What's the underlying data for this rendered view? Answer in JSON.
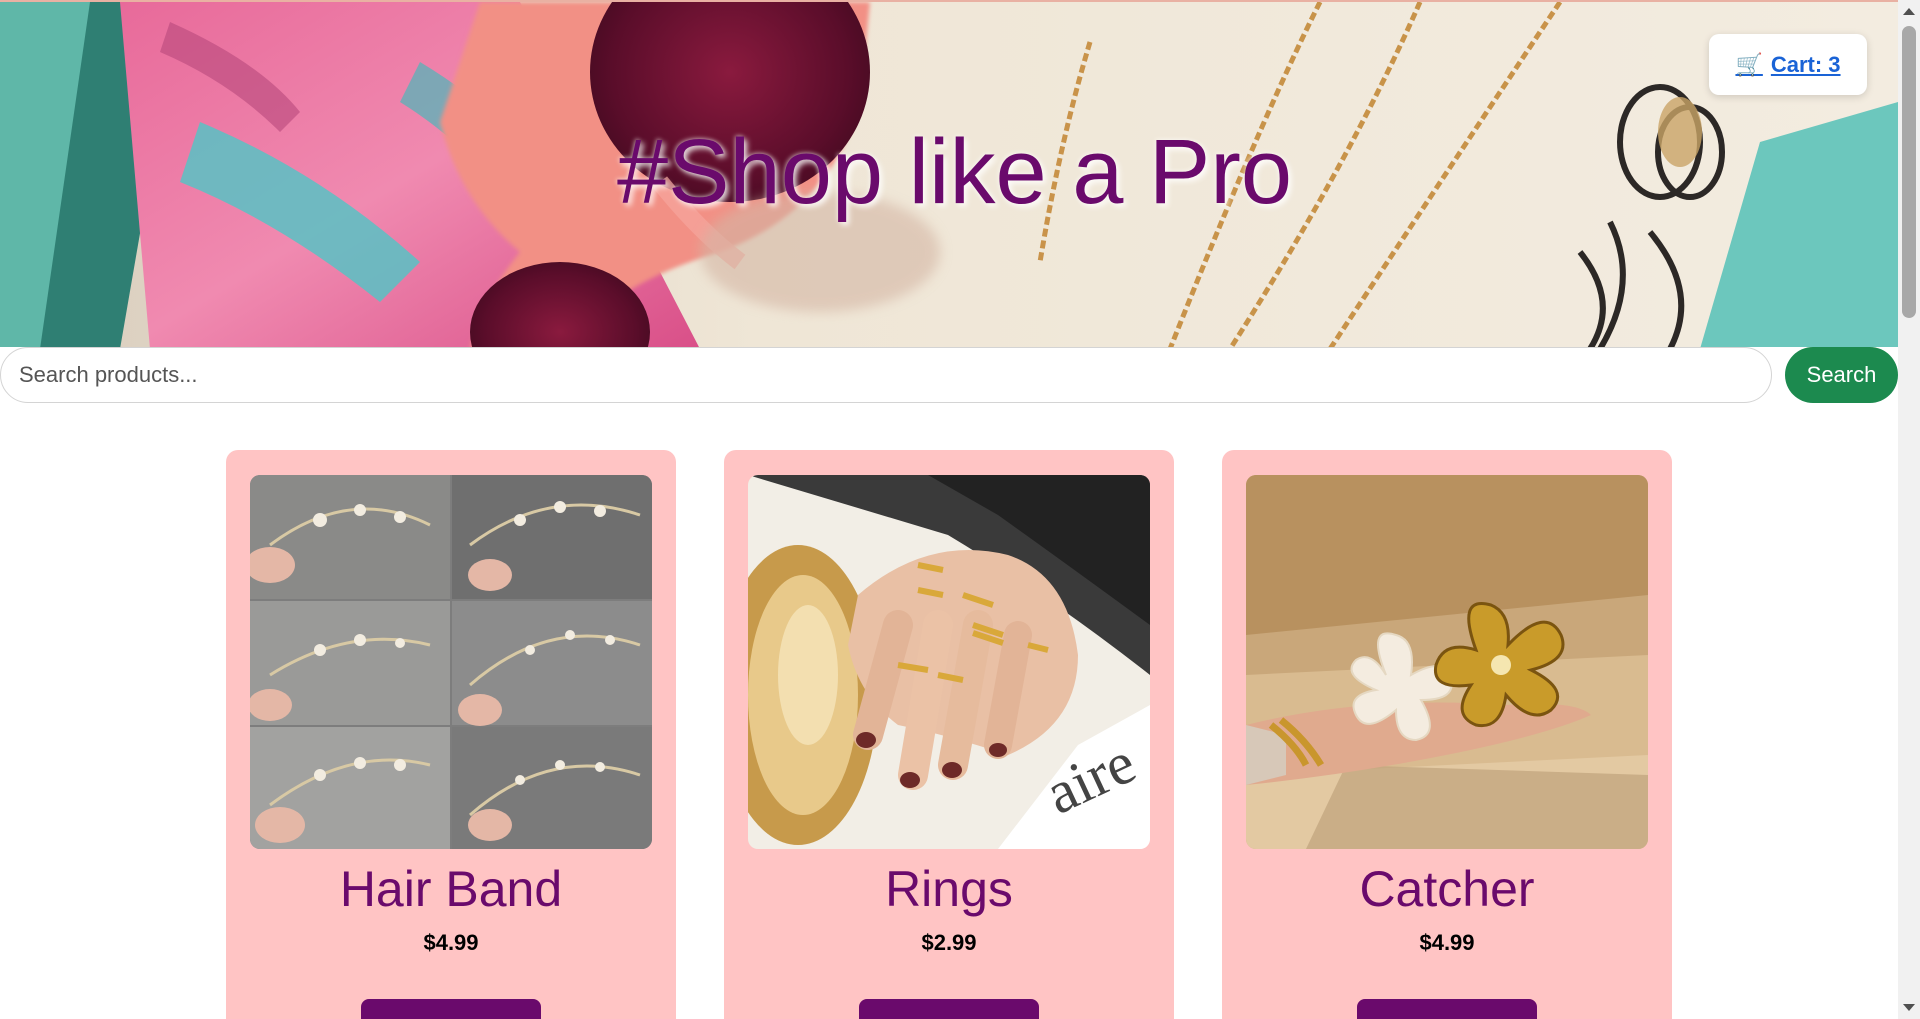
{
  "hero": {
    "title": "#Shop like a Pro",
    "cart_label": "Cart: 3",
    "cart_icon": "shopping-cart-icon"
  },
  "search": {
    "placeholder": "Search products...",
    "button_label": "Search"
  },
  "products": [
    {
      "name": "Hair Band",
      "price": "$4.99",
      "image": "hair-band-photo"
    },
    {
      "name": "Rings",
      "price": "$2.99",
      "image": "rings-photo"
    },
    {
      "name": "Catcher",
      "price": "$4.99",
      "image": "catcher-photo"
    }
  ],
  "colors": {
    "title": "#6a0a6c",
    "card_background": "#ffc4c4",
    "search_button": "#1c8a4f",
    "cart_link": "#1a63d6"
  }
}
